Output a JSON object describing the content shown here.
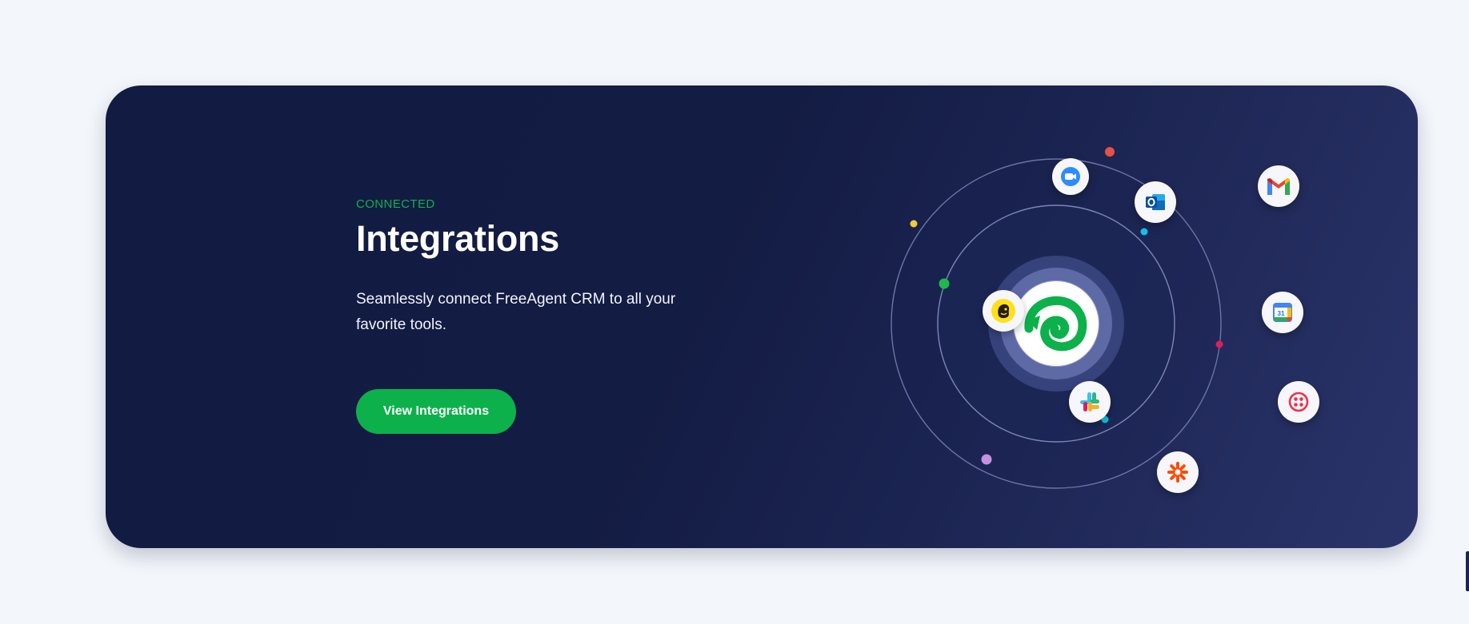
{
  "section": {
    "eyebrow": "CONNECTED",
    "title": "Integrations",
    "description": "Seamlessly connect FreeAgent CRM to all your favorite tools.",
    "cta_label": "View Integrations"
  },
  "integrations": [
    {
      "name": "zoom-icon",
      "accent": "#2d8cff"
    },
    {
      "name": "outlook-icon",
      "accent": "#0f6cbd"
    },
    {
      "name": "gmail-icon",
      "accent": "#ea4335"
    },
    {
      "name": "mailchimp-icon",
      "accent": "#ffe01b"
    },
    {
      "name": "google-calendar-icon",
      "accent": "#4285f4"
    },
    {
      "name": "slack-icon",
      "accent": "#e01e5a"
    },
    {
      "name": "twilio-icon",
      "accent": "#f22f46"
    },
    {
      "name": "zapier-icon",
      "accent": "#ff4a00"
    },
    {
      "name": "freeagent-logo-icon",
      "accent": "#0db14b"
    }
  ],
  "colors": {
    "page_background": "#f3f6fb",
    "card_gradient_start": "#121b41",
    "card_gradient_end": "#2b346a",
    "brand_green": "#0db14b",
    "text_white": "#ffffff"
  }
}
